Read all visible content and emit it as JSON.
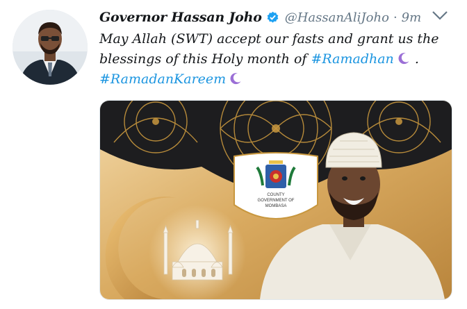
{
  "tweet": {
    "display_name": "Governor Hassan Joho",
    "handle": "@HassanAliJoho",
    "separator": "·",
    "time": "9m",
    "text_line1": "May Allah (SWT) accept our fasts and grant us the",
    "text_line2_prefix": "blessings of this Holy month of ",
    "hashtag1": "#Ramadhan",
    "text_line2_suffix": " .",
    "hashtag2": "#RamadanKareem"
  },
  "media": {
    "emblem_text_line1": "COUNTY",
    "emblem_text_line2": "GOVERNMENT OF",
    "emblem_text_line3": "MOMBASA"
  },
  "colors": {
    "link": "#1b95e0",
    "verified": "#1da1f2",
    "gold": "#c8973e",
    "dark": "#1d1d1f"
  },
  "icons": [
    "verified-badge-icon",
    "chevron-down-icon",
    "crescent-moon-icon"
  ]
}
